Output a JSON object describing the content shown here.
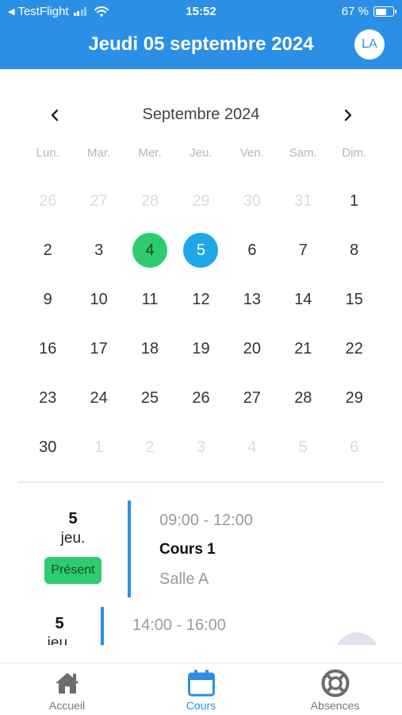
{
  "status_bar": {
    "back_app": "TestFlight",
    "time": "15:52",
    "battery": "67 %",
    "battery_level": 0.67
  },
  "header": {
    "title": "Jeudi 05 septembre 2024",
    "avatar_initials": "LA",
    "background_color": "#2b8fe6"
  },
  "calendar": {
    "month_label": "Septembre 2024",
    "prev_icon": "chevron-left-icon",
    "next_icon": "chevron-right-icon",
    "weekdays": [
      "Lun.",
      "Mar.",
      "Mer.",
      "Jeu.",
      "Ven.",
      "Sam.",
      "Dim."
    ],
    "weeks": [
      [
        {
          "d": "26",
          "m": true
        },
        {
          "d": "27",
          "m": true
        },
        {
          "d": "28",
          "m": true
        },
        {
          "d": "29",
          "m": true
        },
        {
          "d": "30",
          "m": true
        },
        {
          "d": "31",
          "m": true
        },
        {
          "d": "1"
        }
      ],
      [
        {
          "d": "2"
        },
        {
          "d": "3"
        },
        {
          "d": "4",
          "s": "selected"
        },
        {
          "d": "5",
          "s": "today"
        },
        {
          "d": "6"
        },
        {
          "d": "7"
        },
        {
          "d": "8"
        }
      ],
      [
        {
          "d": "9"
        },
        {
          "d": "10"
        },
        {
          "d": "11"
        },
        {
          "d": "12"
        },
        {
          "d": "13"
        },
        {
          "d": "14"
        },
        {
          "d": "15"
        }
      ],
      [
        {
          "d": "16"
        },
        {
          "d": "17"
        },
        {
          "d": "18"
        },
        {
          "d": "19"
        },
        {
          "d": "20"
        },
        {
          "d": "21"
        },
        {
          "d": "22"
        }
      ],
      [
        {
          "d": "23"
        },
        {
          "d": "24"
        },
        {
          "d": "25"
        },
        {
          "d": "26"
        },
        {
          "d": "27"
        },
        {
          "d": "28"
        },
        {
          "d": "29"
        }
      ],
      [
        {
          "d": "30"
        },
        {
          "d": "1",
          "m": true
        },
        {
          "d": "2",
          "m": true
        },
        {
          "d": "3",
          "m": true
        },
        {
          "d": "4",
          "m": true
        },
        {
          "d": "5",
          "m": true
        },
        {
          "d": "6",
          "m": true
        }
      ]
    ],
    "selected_color": "#2ecc71",
    "today_color": "#1ea8e8"
  },
  "events": [
    {
      "day_number": "5",
      "day_name": "jeu.",
      "badge": "Présent",
      "time": "09:00 - 12:00",
      "title": "Cours 1",
      "room": "Salle A"
    },
    {
      "day_number": "5",
      "day_name": "jeu.",
      "time": "14:00 - 16:00"
    }
  ],
  "tabs": [
    {
      "label": "Accueil",
      "icon": "home-icon",
      "active": false
    },
    {
      "label": "Cours",
      "icon": "calendar-icon",
      "active": true
    },
    {
      "label": "Absences",
      "icon": "lifebuoy-icon",
      "active": false
    }
  ]
}
